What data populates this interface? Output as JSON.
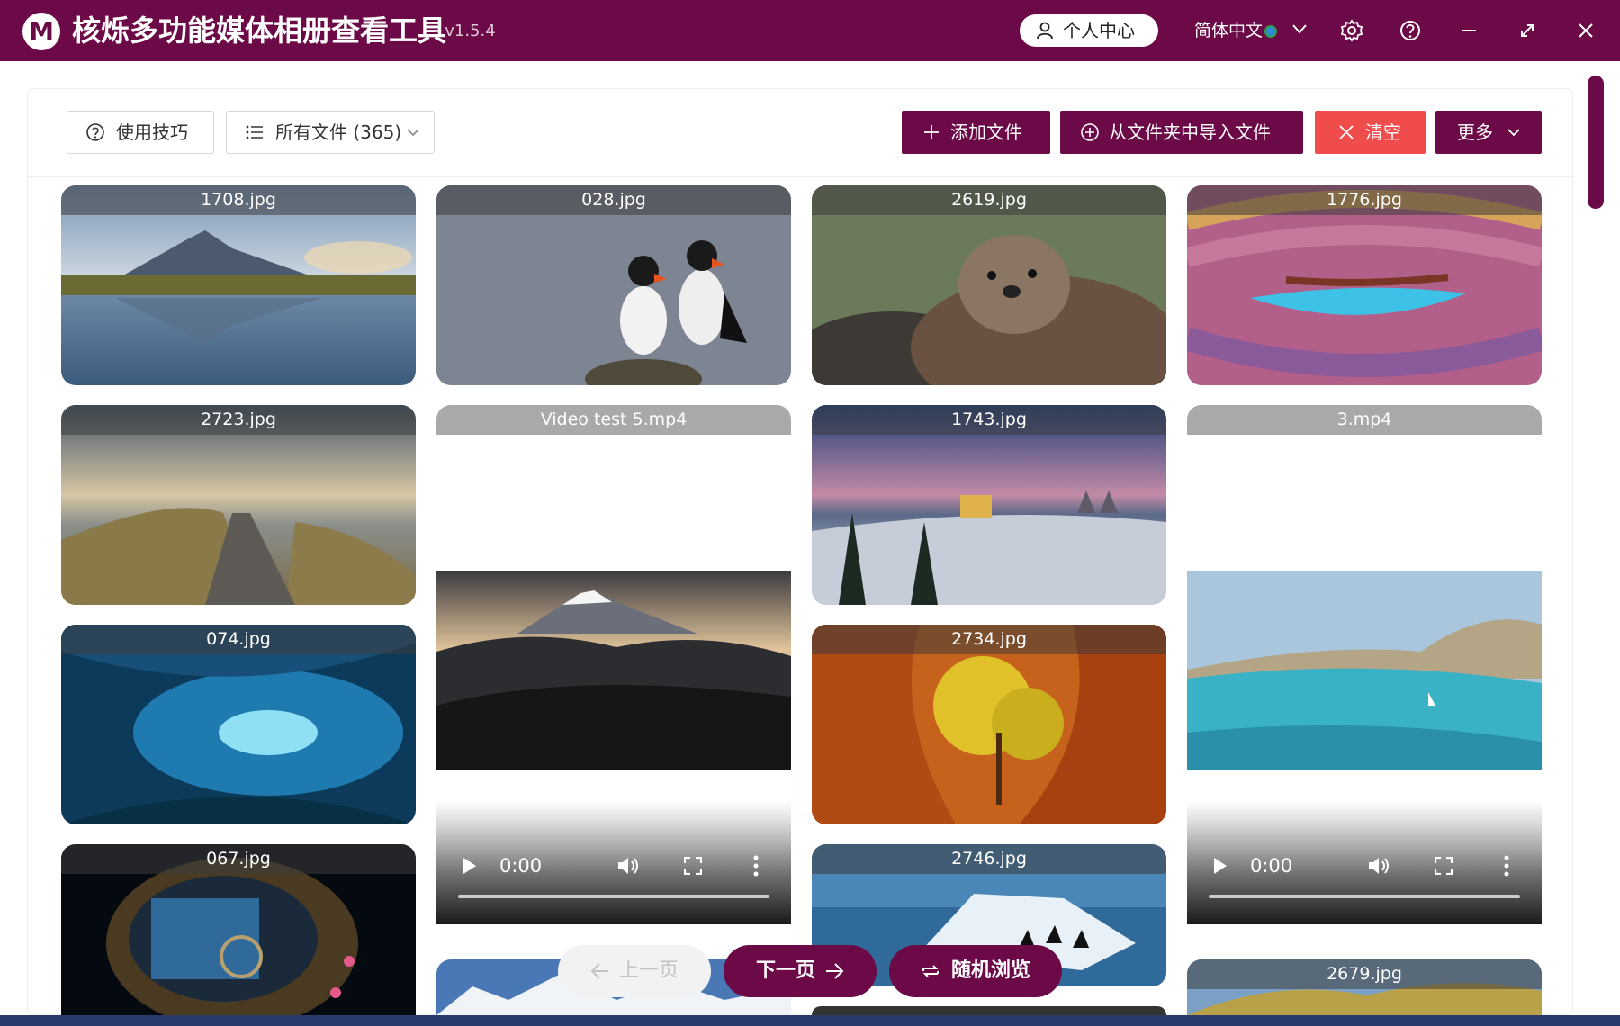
{
  "app": {
    "logo_letter": "M",
    "title": "核烁多功能媒体相册查看工具",
    "version": "- v1.5.4"
  },
  "header": {
    "user_center": "个人中心",
    "language": "简体中文"
  },
  "toolbar": {
    "tips": "使用技巧",
    "filter": "所有文件 (365)",
    "add_files": "添加文件",
    "import_folder": "从文件夹中导入文件",
    "clear": "清空",
    "more": "更多"
  },
  "media": [
    {
      "name": "1708.jpg",
      "type": "image"
    },
    {
      "name": "028.jpg",
      "type": "image"
    },
    {
      "name": "2619.jpg",
      "type": "image"
    },
    {
      "name": "1776.jpg",
      "type": "image"
    },
    {
      "name": "2723.jpg",
      "type": "image"
    },
    {
      "name": "Video test 5.mp4",
      "type": "video",
      "time": "0:00"
    },
    {
      "name": "1743.jpg",
      "type": "image"
    },
    {
      "name": "3.mp4",
      "type": "video",
      "time": "0:00"
    },
    {
      "name": "074.jpg",
      "type": "image"
    },
    {
      "name": "2734.jpg",
      "type": "image"
    },
    {
      "name": "067.jpg",
      "type": "image"
    },
    {
      "name": "2746.jpg",
      "type": "image"
    },
    {
      "name": "2679.jpg",
      "type": "image"
    }
  ],
  "pager": {
    "prev": "上一页",
    "next": "下一页",
    "random": "随机浏览"
  },
  "colors": {
    "brand": "#6b0a47",
    "danger": "#f04c4c"
  }
}
